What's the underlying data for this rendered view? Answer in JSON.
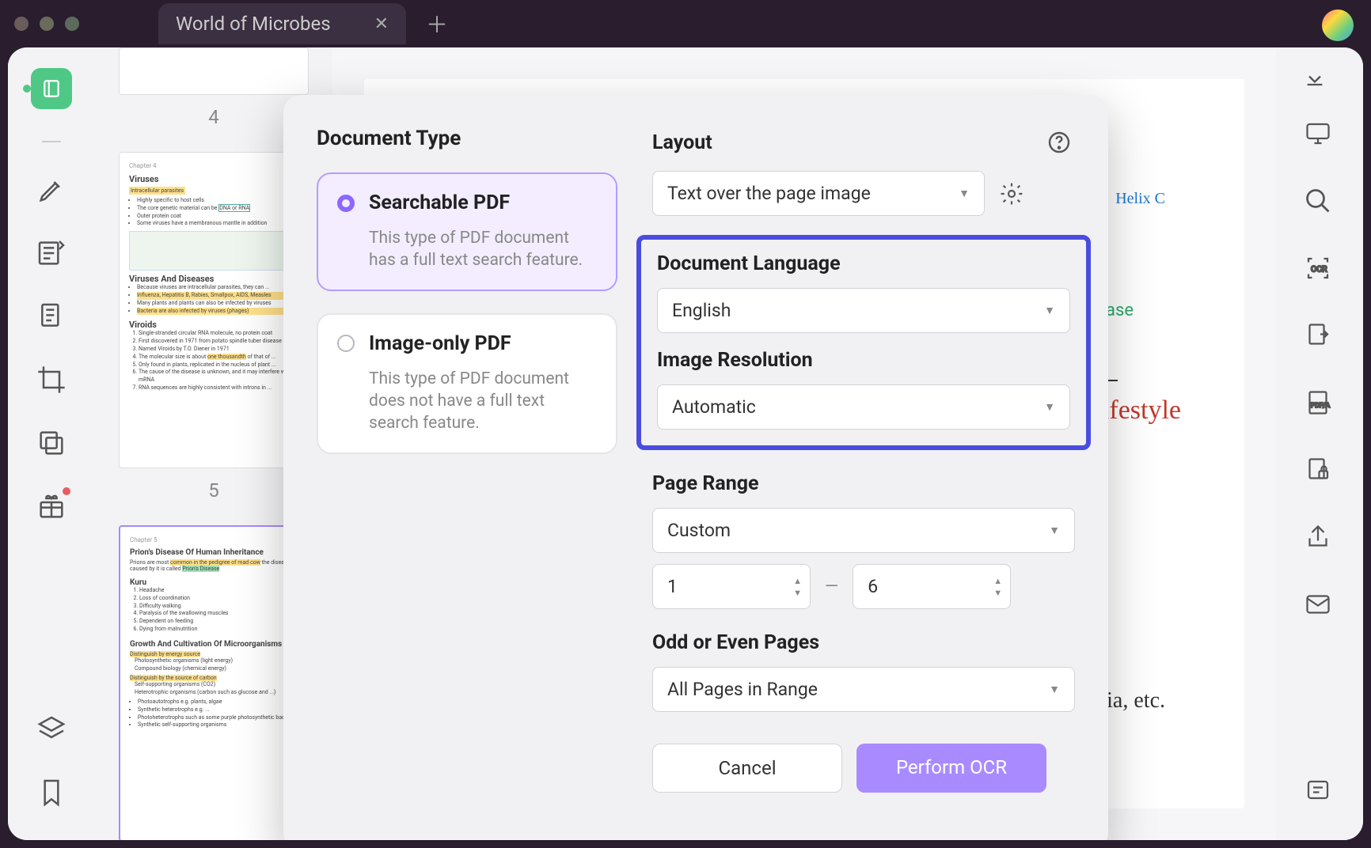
{
  "tab": {
    "title": "World of Microbes"
  },
  "thumbnails": {
    "page4_label": "4",
    "page5_label": "5",
    "page4_headings": [
      "Viruses",
      "Viruses And Diseases",
      "Viroids"
    ],
    "page5_headings": [
      "Prion's Disease Of Human Inheritance",
      "Kuru",
      "Growth And Cultivation Of Microorganisms"
    ]
  },
  "modal": {
    "left": {
      "title": "Document Type",
      "options": [
        {
          "title": "Searchable PDF",
          "desc": "This type of PDF document has a full text search feature."
        },
        {
          "title": "Image-only PDF",
          "desc": "This type of PDF document does not have a full text search feature."
        }
      ]
    },
    "right": {
      "layout_label": "Layout",
      "layout_value": "Text over the page image",
      "lang_label": "Document Language",
      "lang_value": "English",
      "res_label": "Image Resolution",
      "res_value": "Automatic",
      "range_label": "Page Range",
      "range_value": "Custom",
      "range_from": "1",
      "range_to": "6",
      "oddeven_label": "Odd or Even Pages",
      "oddeven_value": "All Pages in Range",
      "cancel": "Cancel",
      "confirm": "Perform OCR"
    }
  },
  "background_text": {
    "helix": "Helix C",
    "disease": "n Disease",
    "lifestyle": "Lifestyle",
    "ria": "ria, etc.",
    "photo": "Photosynthetic organisms:"
  }
}
